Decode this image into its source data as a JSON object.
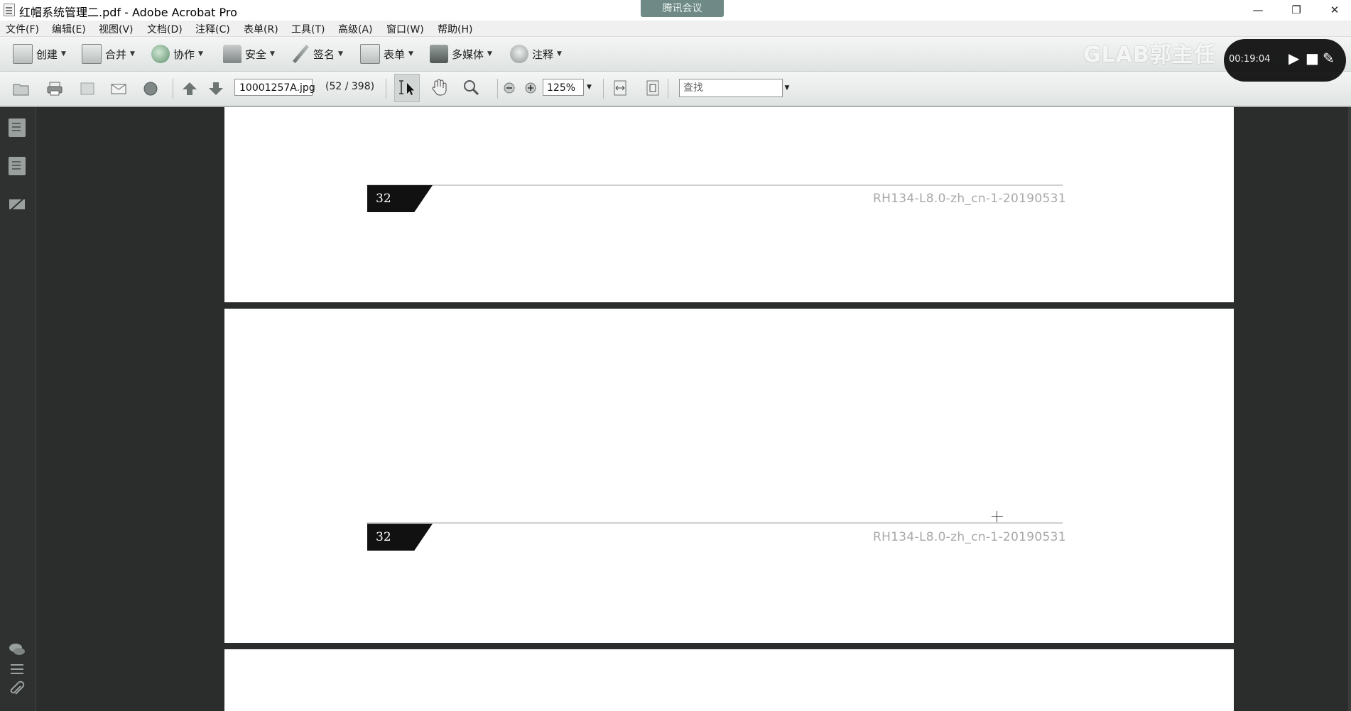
{
  "window": {
    "title": "红帽系统管理二.pdf - Adobe Acrobat Pro",
    "meeting_tab": "腾讯会议",
    "minimize": "—",
    "restore": "❐",
    "close": "✕"
  },
  "menu": [
    {
      "label": "文件(F)"
    },
    {
      "label": "编辑(E)"
    },
    {
      "label": "视图(V)"
    },
    {
      "label": "文档(D)"
    },
    {
      "label": "注释(C)"
    },
    {
      "label": "表单(R)"
    },
    {
      "label": "工具(T)"
    },
    {
      "label": "高级(A)"
    },
    {
      "label": "窗口(W)"
    },
    {
      "label": "帮助(H)"
    }
  ],
  "toolbar": {
    "create": "创建",
    "combine": "合并",
    "collaborate": "协作",
    "secure": "安全",
    "sign": "签名",
    "forms": "表单",
    "multimedia": "多媒体",
    "comment": "注释"
  },
  "nav": {
    "page_field": "10001257A.jpg",
    "page_count": "(52 / 398)",
    "zoom": "125%",
    "search_placeholder": "查找"
  },
  "overlay": {
    "watermark": "GLAB郭主任",
    "player_time": "00:19:04"
  },
  "document": {
    "pages": [
      {
        "page_number": "32",
        "code": "RH134-L8.0-zh_cn-1-20190531"
      },
      {
        "page_number": "32",
        "code": "RH134-L8.0-zh_cn-1-20190531"
      }
    ]
  },
  "icons": [
    "document-icon",
    "print-icon",
    "email-icon",
    "folder-open-icon",
    "hand-icon",
    "zoom-icon",
    "arrow-up-icon",
    "arrow-down-icon",
    "text-select-icon",
    "pages-panel-icon",
    "bookmarks-icon",
    "signatures-icon",
    "comments-icon",
    "layers-icon",
    "attachment-icon"
  ]
}
